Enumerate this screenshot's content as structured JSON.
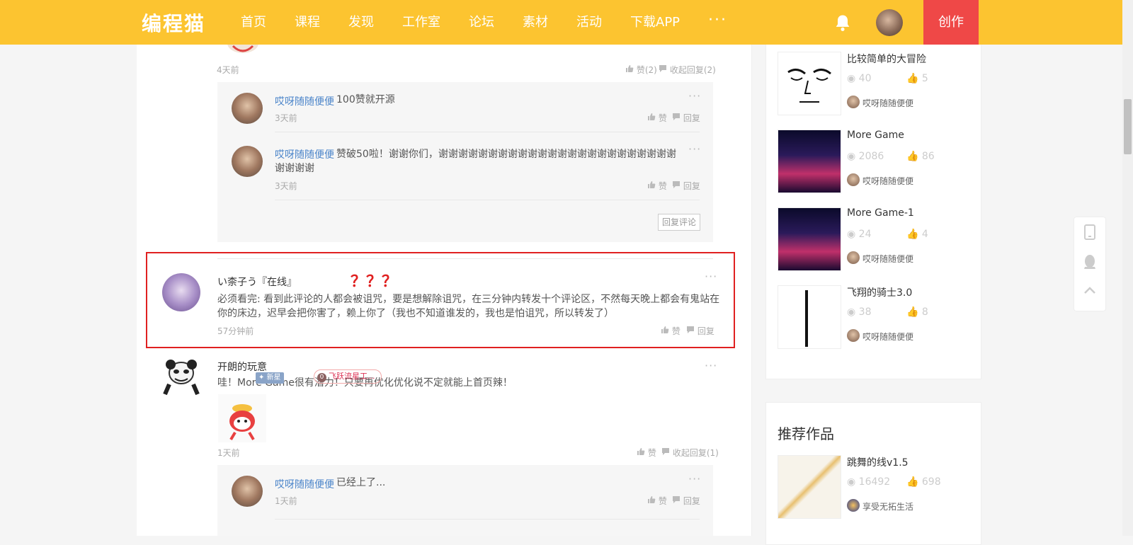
{
  "header": {
    "logo": "编程猫",
    "nav": [
      "首页",
      "课程",
      "发现",
      "工作室",
      "论坛",
      "素材",
      "活动",
      "下载APP"
    ],
    "more": "···",
    "create": "创作"
  },
  "thread1": {
    "time": "4天前",
    "like": "赞(2)",
    "collapse": "收起回复(2)",
    "replies": [
      {
        "user": "哎呀随随便便",
        "text": "100赞就开源",
        "time": "3天前",
        "like": "赞",
        "reply": "回复"
      },
      {
        "user": "哎呀随随便便",
        "text": "赞破50啦！谢谢你们，谢谢谢谢谢谢谢谢谢谢谢谢谢谢谢谢谢谢谢谢谢谢谢谢谢谢谢谢",
        "time": "3天前",
        "like": "赞",
        "reply": "回复"
      }
    ],
    "reply_comment": "回复评论"
  },
  "highlight_comment": {
    "user": "い柰子う『在线』",
    "marks": "？？？",
    "text": "必须看完: 看到此评论的人都会被诅咒，要是想解除诅咒，在三分钟内转发十个评论区，不然每天晚上都会有鬼站在你的床边，迟早会把你害了，赖上你了（我也不知道谁发的，我也是怕诅咒，所以转发了）",
    "time": "57分钟前",
    "like": "赞",
    "reply": "回复"
  },
  "comment3": {
    "user": "开朗的玩意",
    "badge_new": "新星",
    "badge_level": "0",
    "badge_title": "飞跃流星工...",
    "text": "哇！More Game很有潜力！只要再优化优化说不定就能上首页辣！",
    "time": "1天前",
    "like": "赞",
    "collapse": "收起回复(1)",
    "reply": {
      "user": "哎呀随随便便",
      "text": "已经上了...",
      "time": "1天前",
      "like": "赞",
      "reply": "回复"
    }
  },
  "sidebar_works": [
    {
      "title": "比较简单的大冒险",
      "views": "40",
      "likes": "5",
      "author": "哎呀随随便便"
    },
    {
      "title": "More Game",
      "views": "2086",
      "likes": "86",
      "author": "哎呀随随便便"
    },
    {
      "title": "More Game-1",
      "views": "24",
      "likes": "4",
      "author": "哎呀随随便便"
    },
    {
      "title": "飞翔的骑士3.0",
      "views": "38",
      "likes": "8",
      "author": "哎呀随随便便"
    }
  ],
  "recommended": {
    "heading": "推荐作品",
    "items": [
      {
        "title": "跳舞的线v1.5",
        "views": "16492",
        "likes": "698",
        "author": "享受无拓生活"
      }
    ]
  },
  "colors": {
    "header": "#fcc430",
    "create": "#ef4847",
    "username": "#4a84c9",
    "highlight_border": "#e02020"
  }
}
